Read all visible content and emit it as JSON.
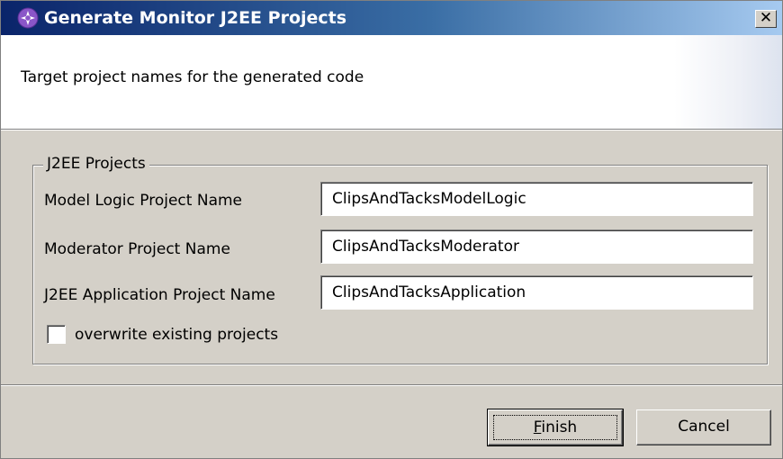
{
  "window": {
    "title": "Generate Monitor J2EE Projects",
    "close_glyph": "✕",
    "title_icon": "monitor-wizard-icon"
  },
  "banner": {
    "message": "Target project names for the generated code"
  },
  "group": {
    "legend": "J2EE Projects",
    "fields": [
      {
        "label": "Model Logic Project Name",
        "value": "ClipsAndTacksModelLogic"
      },
      {
        "label": "Moderator Project Name",
        "value": "ClipsAndTacksModerator"
      },
      {
        "label": "J2EE Application Project Name",
        "value": "ClipsAndTacksApplication"
      }
    ],
    "overwrite": {
      "label": "overwrite existing projects",
      "checked": false
    }
  },
  "buttons": {
    "finish_mnemonic": "F",
    "finish_rest": "inish",
    "cancel": "Cancel"
  }
}
